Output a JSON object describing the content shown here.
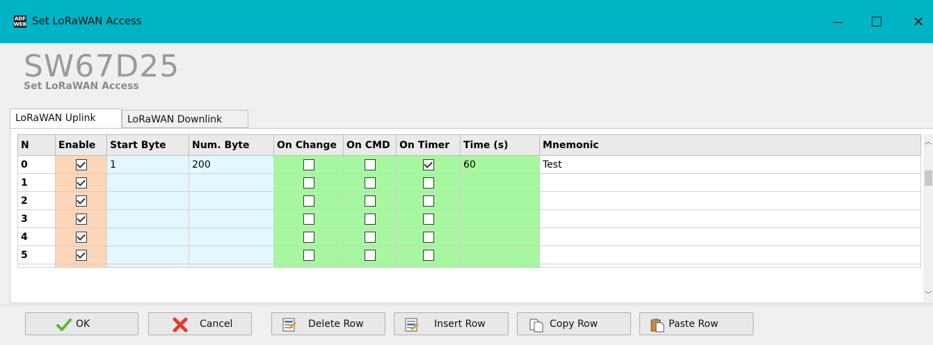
{
  "window": {
    "title": "Set LoRaWAN Access",
    "icon_text": "ADF WEB",
    "controls": [
      "minimize",
      "maximize",
      "close"
    ]
  },
  "header": {
    "title": "SW67D25",
    "subtitle": "Set LoRaWAN Access"
  },
  "tabs": [
    {
      "label": "LoRaWAN Uplink",
      "active": true
    },
    {
      "label": "LoRaWAN Downlink",
      "active": false
    }
  ],
  "table": {
    "columns": [
      "N",
      "Enable",
      "Start Byte",
      "Num. Byte",
      "On Change",
      "On CMD",
      "On Timer",
      "Time (s)",
      "Mnemonic"
    ],
    "rows": [
      {
        "n": "0",
        "enable": true,
        "start_byte": "1",
        "num_byte": "200",
        "on_change": false,
        "on_cmd": false,
        "on_timer": true,
        "time": "60",
        "mnemonic": "Test"
      },
      {
        "n": "1",
        "enable": true,
        "start_byte": "",
        "num_byte": "",
        "on_change": false,
        "on_cmd": false,
        "on_timer": false,
        "time": "",
        "mnemonic": ""
      },
      {
        "n": "2",
        "enable": true,
        "start_byte": "",
        "num_byte": "",
        "on_change": false,
        "on_cmd": false,
        "on_timer": false,
        "time": "",
        "mnemonic": ""
      },
      {
        "n": "3",
        "enable": true,
        "start_byte": "",
        "num_byte": "",
        "on_change": false,
        "on_cmd": false,
        "on_timer": false,
        "time": "",
        "mnemonic": ""
      },
      {
        "n": "4",
        "enable": true,
        "start_byte": "",
        "num_byte": "",
        "on_change": false,
        "on_cmd": false,
        "on_timer": false,
        "time": "",
        "mnemonic": ""
      },
      {
        "n": "5",
        "enable": true,
        "start_byte": "",
        "num_byte": "",
        "on_change": false,
        "on_cmd": false,
        "on_timer": false,
        "time": "",
        "mnemonic": ""
      }
    ]
  },
  "buttons": {
    "ok": "OK",
    "cancel": "Cancel",
    "delete_row": "Delete Row",
    "insert_row": "Insert Row",
    "copy_row": "Copy Row",
    "paste_row": "Paste Row"
  },
  "colors": {
    "titlebar": "#00b4c6",
    "enable_col": "#fcd6b8",
    "byte_cols": "#e3f8fc",
    "timer_cols": "#a7f7a0"
  }
}
